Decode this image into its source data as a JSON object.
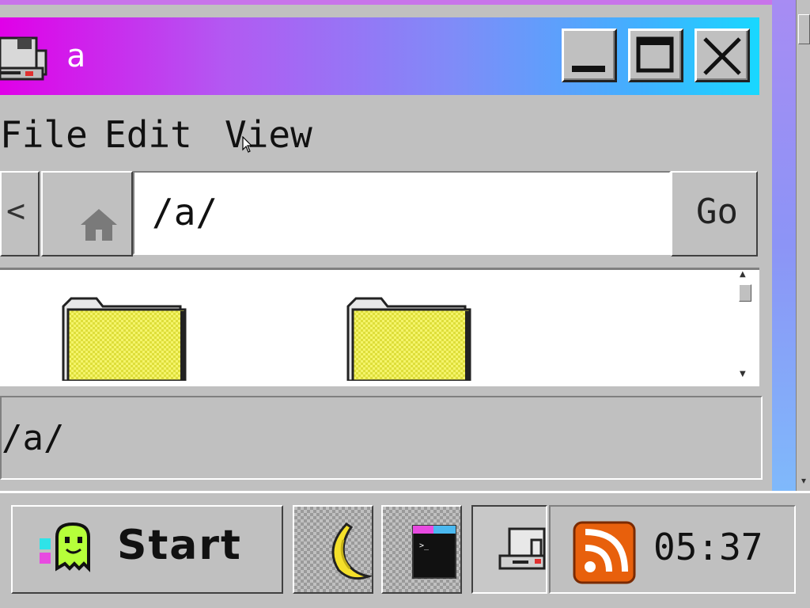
{
  "window": {
    "title": "a",
    "gradient_colors": [
      "#e000e8",
      "#7f8cf8",
      "#18d8ff"
    ],
    "controls": {
      "minimize_icon": "minimize-icon",
      "maximize_icon": "maximize-icon",
      "close_icon": "close-icon"
    }
  },
  "menu": {
    "items": [
      {
        "label": "File"
      },
      {
        "label": "Edit"
      },
      {
        "label": "View"
      }
    ]
  },
  "address_bar": {
    "back_label": "<",
    "home_icon": "home-icon",
    "path": "/a/",
    "go_label": "Go"
  },
  "files": {
    "items": [
      {
        "icon": "folder-icon",
        "color": "#e6e64a"
      },
      {
        "icon": "folder-icon",
        "color": "#e6e64a"
      }
    ]
  },
  "status_bar": {
    "text": "/a/"
  },
  "taskbar": {
    "start_label": "Start",
    "start_icon": "ghost-icon",
    "tasks": [
      {
        "icon": "banana-icon"
      },
      {
        "icon": "terminal-icon"
      },
      {
        "icon": "file-manager-icon",
        "active": true
      }
    ],
    "tray": {
      "feed_icon": "rss-icon",
      "feed_color": "#e8600c",
      "clock": "05:37"
    }
  }
}
